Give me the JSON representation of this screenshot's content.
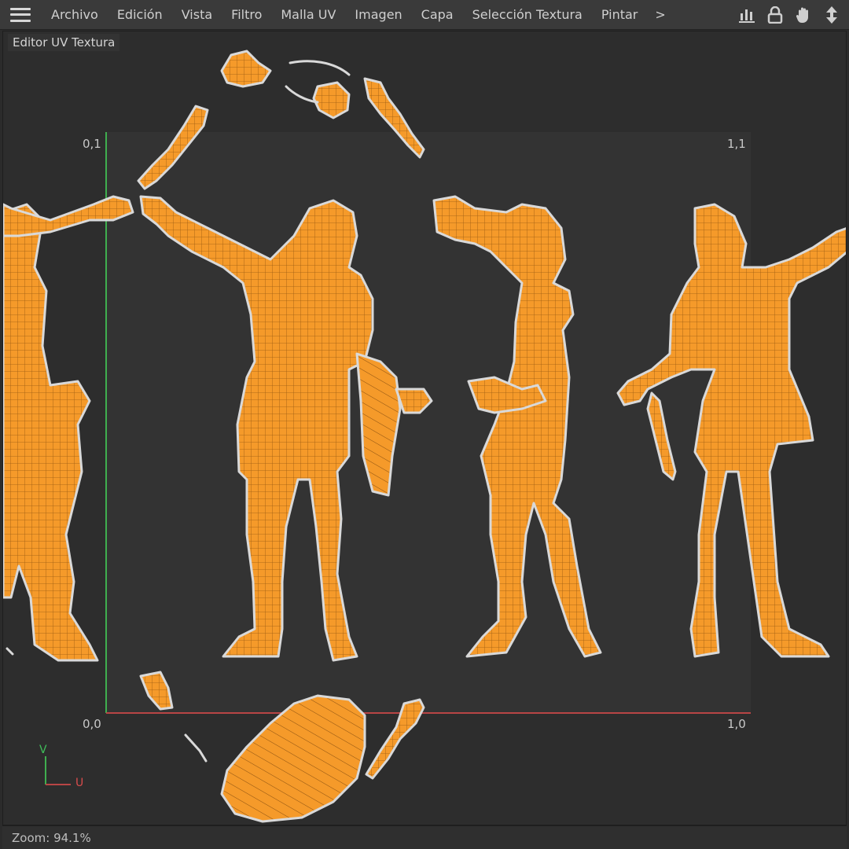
{
  "menubar": {
    "items": [
      "Archivo",
      "Edición",
      "Vista",
      "Filtro",
      "Malla UV",
      "Imagen",
      "Capa",
      "Selección Textura",
      "Pintar"
    ],
    "more": ">"
  },
  "toolbar": {
    "icons": [
      "chart-icon",
      "lock-icon",
      "hand-icon",
      "move-vertical-icon"
    ]
  },
  "panel": {
    "title": "Editor UV Textura"
  },
  "uv": {
    "corner_tl": "0,1",
    "corner_tr": "1,1",
    "corner_bl": "0,0",
    "corner_br": "1,0",
    "axis_v": "V",
    "axis_u": "U",
    "colors": {
      "background": "#2d2d2d",
      "uv_square": "#333333",
      "island_fill": "#f59a2a",
      "island_edge": "#d9d9d9",
      "v_axis": "#3fae4f",
      "u_axis": "#b84545"
    }
  },
  "status": {
    "zoom": "Zoom: 94.1%"
  }
}
